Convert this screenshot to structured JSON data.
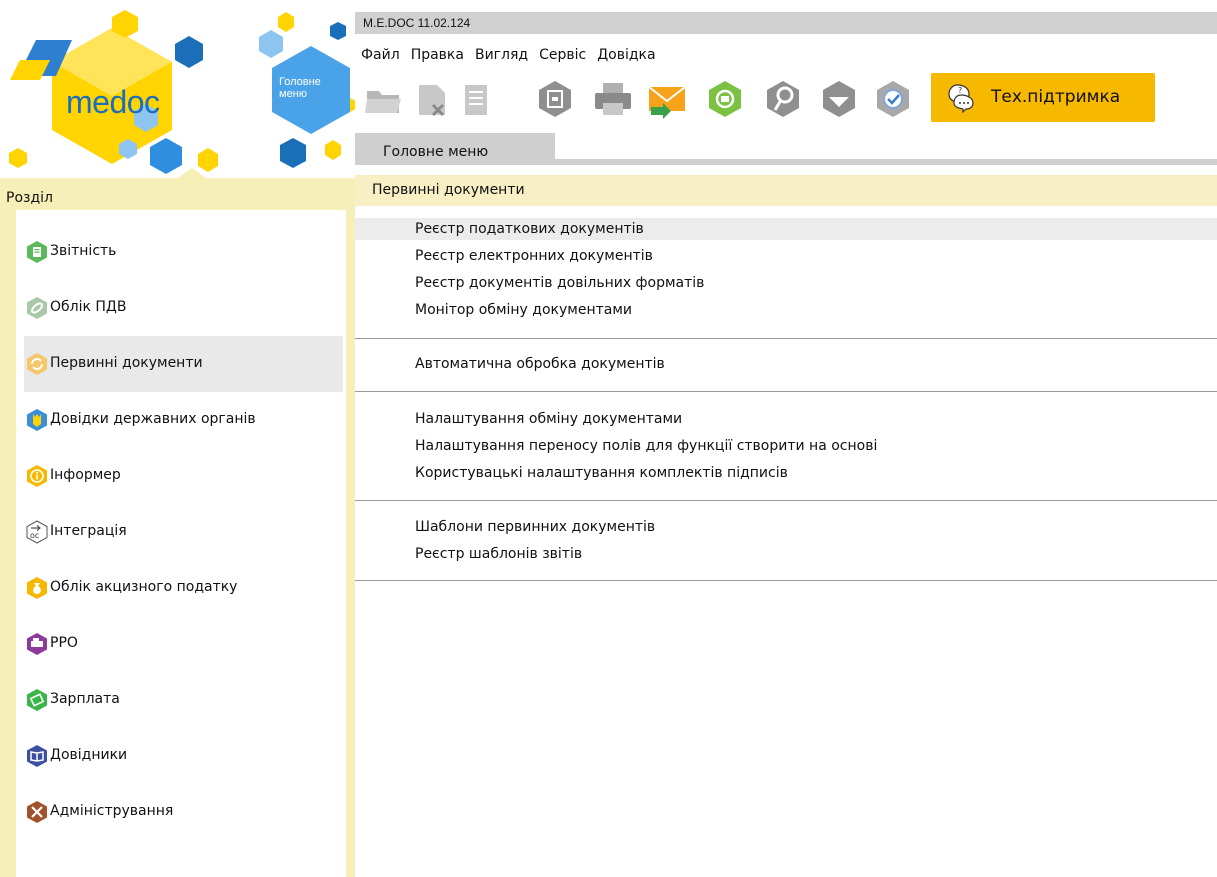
{
  "logo": {
    "me": "me",
    "doc": "doc"
  },
  "main_menu_hex": {
    "label": "Головне меню"
  },
  "titlebar": {
    "title": "M.E.DOC 11.02.124"
  },
  "menubar": {
    "items": [
      "Файл",
      "Правка",
      "Вигляд",
      "Сервіс",
      "Довідка"
    ]
  },
  "toolbar": {
    "icons": [
      "open-icon",
      "delete-document-icon",
      "copy-document-icon",
      "archive-icon",
      "print-icon",
      "send-envelope-icon",
      "receive-icon",
      "key-search-icon",
      "download-icon",
      "verify-signature-icon"
    ],
    "support_label": "Тех.підтримка"
  },
  "tabs": {
    "main": "Головне меню"
  },
  "sidebar": {
    "header": "Розділ",
    "items": [
      {
        "label": "Звітність",
        "icon": "report-icon",
        "color": "#5cb85c"
      },
      {
        "label": "Облік ПДВ",
        "icon": "vat-link-icon",
        "color": "#9bbf9b"
      },
      {
        "label": "Первинні документи",
        "icon": "primary-docs-icon",
        "color": "#f5c66a"
      },
      {
        "label": "Довідки державних органів",
        "icon": "state-emblem-icon",
        "color": "#3a8fd8"
      },
      {
        "label": "Інформер",
        "icon": "info-icon",
        "color": "#f7b800"
      },
      {
        "label": "Інтеграція",
        "icon": "integration-icon",
        "color": "#555555"
      },
      {
        "label": "Облік акцизного податку",
        "icon": "excise-bag-icon",
        "color": "#f7b800"
      },
      {
        "label": "РРО",
        "icon": "cash-register-icon",
        "color": "#8e3a9d"
      },
      {
        "label": "Зарплата",
        "icon": "salary-icon",
        "color": "#3ab54a"
      },
      {
        "label": "Довідники",
        "icon": "book-icon",
        "color": "#3d4fa0"
      },
      {
        "label": "Адміністрування",
        "icon": "tools-icon",
        "color": "#a0522d"
      }
    ]
  },
  "content": {
    "section_title": "Первинні документи",
    "groups": [
      [
        "Реєстр податкових документів",
        "Реєстр електронних документів",
        "Реєстр документів довільних форматів",
        "Монітор обміну документами"
      ],
      [
        "Автоматична обробка документів"
      ],
      [
        "Налаштування обміну документами",
        "Налаштування переносу полів для функції створити на основі",
        "Користувацькі налаштування комплектів підписів"
      ],
      [
        "Шаблони первинних документів",
        "Реєстр шаблонів звітів"
      ]
    ]
  },
  "colors": {
    "accent": "#f7b800",
    "sidebar_bg": "#f7efb8",
    "section_bg": "#f8f0c4",
    "logo_blue": "#1b6fb8"
  }
}
